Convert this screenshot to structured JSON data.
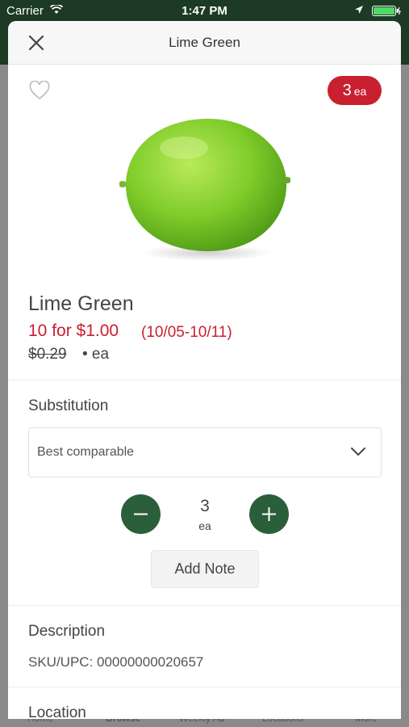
{
  "status_bar": {
    "carrier": "Carrier",
    "time": "1:47 PM"
  },
  "background_tabs": [
    "Home",
    "Browse",
    "Weekly Ad",
    "Locations",
    "More"
  ],
  "modal": {
    "title": "Lime Green",
    "close_icon": "close-icon"
  },
  "product": {
    "name": "Lime Green",
    "badge": {
      "quantity": "3",
      "unit": "ea"
    },
    "sale_price": "10 for $1.00",
    "sale_dates": "(10/05-10/11)",
    "original_price": "$0.29",
    "original_unit": "• ea",
    "favorite_icon": "heart-outline-icon"
  },
  "substitution": {
    "label": "Substitution",
    "selected": "Best comparable"
  },
  "stepper": {
    "value": "3",
    "unit": "ea"
  },
  "note_button": {
    "label": "Add Note"
  },
  "description": {
    "label": "Description",
    "sku": "SKU/UPC: 00000000020657"
  },
  "location": {
    "label": "Location"
  },
  "colors": {
    "accent_green": "#2b5e3a",
    "sale_red": "#c8202f",
    "header_green": "#1c3a24"
  }
}
